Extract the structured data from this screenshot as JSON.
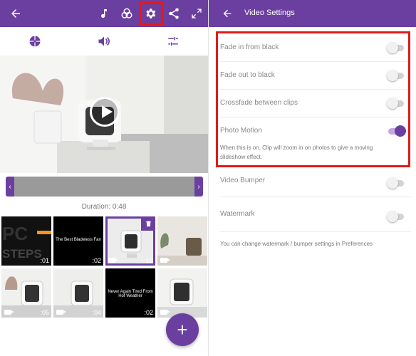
{
  "left": {
    "topbar": {
      "icons": [
        "back-arrow-icon",
        "music-note-icon",
        "color-filter-icon",
        "gear-icon",
        "share-icon",
        "expand-icon"
      ]
    },
    "toolbar": {
      "icons": [
        "theme-icon",
        "volume-icon",
        "adjust-sliders-icon"
      ]
    },
    "duration": "Duration: 0:48",
    "thumbnails": [
      {
        "label": ":01",
        "caption": "",
        "video": false
      },
      {
        "label": ":02",
        "caption": "The Best Bladeless Fan",
        "video": false
      },
      {
        "label": ":10",
        "caption": "",
        "video": true,
        "selected": true
      },
      {
        "label": "",
        "caption": "",
        "video": true
      },
      {
        "label": ":05",
        "caption": "",
        "video": true
      },
      {
        "label": ":04",
        "caption": "",
        "video": true
      },
      {
        "label": ":02",
        "caption": "Never Again Tired From Hot Weather",
        "video": false
      },
      {
        "label": "",
        "caption": "",
        "video": true
      }
    ],
    "fab_label": "+"
  },
  "right": {
    "title": "Video Settings",
    "settings": [
      {
        "label": "Fade in from black",
        "on": false
      },
      {
        "label": "Fade out to black",
        "on": false
      },
      {
        "label": "Crossfade between clips",
        "on": false
      },
      {
        "label": "Photo Motion",
        "on": true,
        "description": "When this is on, Clip will zoom in on photos to give a moving slideshow effect."
      },
      {
        "label": "Video Bumper",
        "on": false
      },
      {
        "label": "Watermark",
        "on": false
      }
    ],
    "footer": "You can change watermark / bumper settings in Preferences"
  },
  "colors": {
    "accent": "#6b3fa0",
    "highlight": "#e11a1a"
  }
}
